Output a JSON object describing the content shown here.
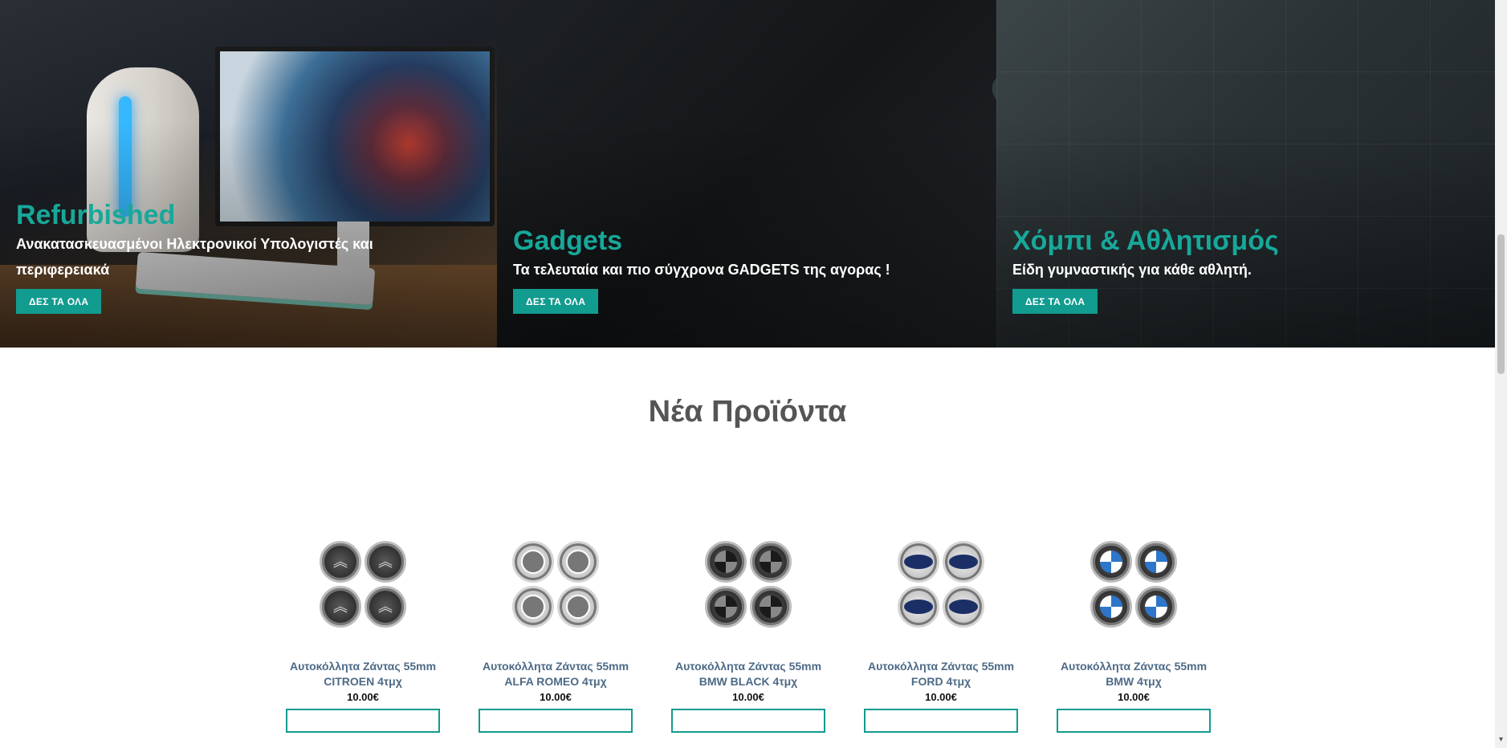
{
  "banners": [
    {
      "title": "Refurbished",
      "description": "Ανακατασκευασμένοι Ηλεκτρονικοί Υπολογιστές και περιφερειακά",
      "button_label": "ΔΕΣ ΤΑ ΟΛΑ"
    },
    {
      "title": "Gadgets",
      "description": "Τα τελευταία και πιο σύγχρονα GADGETS της αγορας !",
      "button_label": "ΔΕΣ ΤΑ ΟΛΑ"
    },
    {
      "title": "Χόμπι & Αθλητισμός",
      "description": "Είδη γυμναστικής για κάθε αθλητή.",
      "button_label": "ΔΕΣ ΤΑ ΟΛΑ"
    }
  ],
  "new_products": {
    "title": "Νέα Προϊόντα",
    "items": [
      {
        "name_line1": "Αυτοκόλλητα Ζάντας 55mm",
        "name_line2": "CITROEN 4τμχ",
        "price": "10.00€",
        "image_icon": "citroen-wheel-caps"
      },
      {
        "name_line1": "Αυτοκόλλητα Ζάντας 55mm",
        "name_line2": "ALFA ROMEO 4τμχ",
        "price": "10.00€",
        "image_icon": "alfa-romeo-wheel-caps"
      },
      {
        "name_line1": "Αυτοκόλλητα Ζάντας 55mm",
        "name_line2": "BMW BLACK 4τμχ",
        "price": "10.00€",
        "image_icon": "bmw-black-wheel-caps"
      },
      {
        "name_line1": "Αυτοκόλλητα Ζάντας 55mm",
        "name_line2": "FORD 4τμχ",
        "price": "10.00€",
        "image_icon": "ford-wheel-caps"
      },
      {
        "name_line1": "Αυτοκόλλητα Ζάντας 55mm",
        "name_line2": "BMW 4τμχ",
        "price": "10.00€",
        "image_icon": "bmw-wheel-caps"
      }
    ]
  },
  "colors": {
    "accent": "#129b8f",
    "banner_title": "#17a89a",
    "product_name": "#4d6a86",
    "section_title": "#555555"
  }
}
